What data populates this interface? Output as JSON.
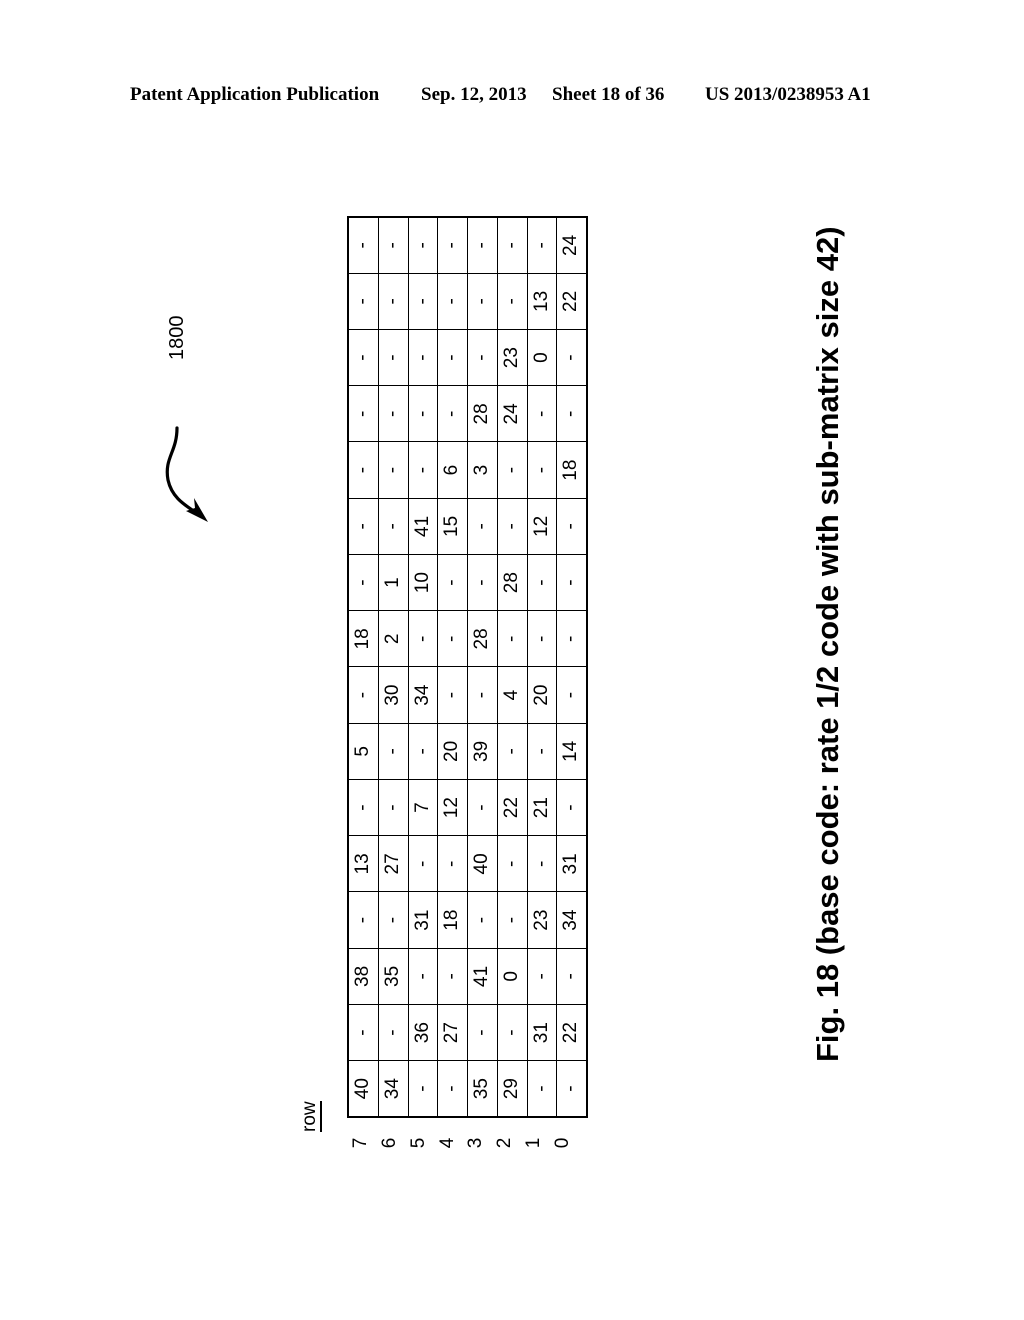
{
  "header": {
    "publication": "Patent Application Publication",
    "date": "Sep. 12, 2013",
    "sheet": "Sheet 18 of 36",
    "number": "US 2013/0238953 A1"
  },
  "figure": {
    "reference_numeral": "1800",
    "caption": "Fig. 18 (base code: rate 1/2 code with sub-matrix size 42)",
    "row_axis_title": "row",
    "row_labels": [
      "7",
      "6",
      "5",
      "4",
      "3",
      "2",
      "1",
      "0"
    ],
    "empty_symbol": "-"
  },
  "chart_data": {
    "type": "table",
    "title": "Fig. 18 (base code: rate 1/2 code with sub-matrix size 42)",
    "xlabel": "",
    "ylabel": "row",
    "row_labels": [
      "7",
      "6",
      "5",
      "4",
      "3",
      "2",
      "1",
      "0"
    ],
    "n_rows": 8,
    "n_cols": 16,
    "empty_symbol": "-",
    "note": "Parity-check base matrix. Rows listed top-to-bottom as shown (row 7 first). Each row has 16 column entries, listed left-to-right as rendered in the landscape figure.",
    "rows": [
      [
        "40",
        "-",
        "38",
        "-",
        "13",
        "-",
        "5",
        "-",
        "18",
        "-",
        "-",
        "-",
        "-",
        "-",
        "-",
        "-"
      ],
      [
        "34",
        "-",
        "35",
        "-",
        "27",
        "-",
        "-",
        "30",
        "2",
        "1",
        "-",
        "-",
        "-",
        "-",
        "-",
        "-"
      ],
      [
        "-",
        "36",
        "-",
        "31",
        "-",
        "7",
        "-",
        "34",
        "-",
        "10",
        "41",
        "-",
        "-",
        "-",
        "-",
        "-"
      ],
      [
        "-",
        "27",
        "-",
        "18",
        "-",
        "12",
        "20",
        "-",
        "-",
        "-",
        "15",
        "6",
        "-",
        "-",
        "-",
        "-"
      ],
      [
        "35",
        "-",
        "41",
        "-",
        "40",
        "-",
        "39",
        "-",
        "28",
        "-",
        "-",
        "3",
        "28",
        "-",
        "-",
        "-"
      ],
      [
        "29",
        "-",
        "0",
        "-",
        "-",
        "22",
        "-",
        "4",
        "-",
        "28",
        "-",
        "-",
        "24",
        "23",
        "-",
        "-"
      ],
      [
        "-",
        "31",
        "-",
        "23",
        "-",
        "21",
        "-",
        "20",
        "-",
        "-",
        "12",
        "-",
        "-",
        "0",
        "13",
        "-"
      ],
      [
        "-",
        "22",
        "-",
        "34",
        "31",
        "-",
        "14",
        "-",
        "-",
        "-",
        "-",
        "18",
        "-",
        "-",
        "22",
        "24"
      ]
    ]
  }
}
